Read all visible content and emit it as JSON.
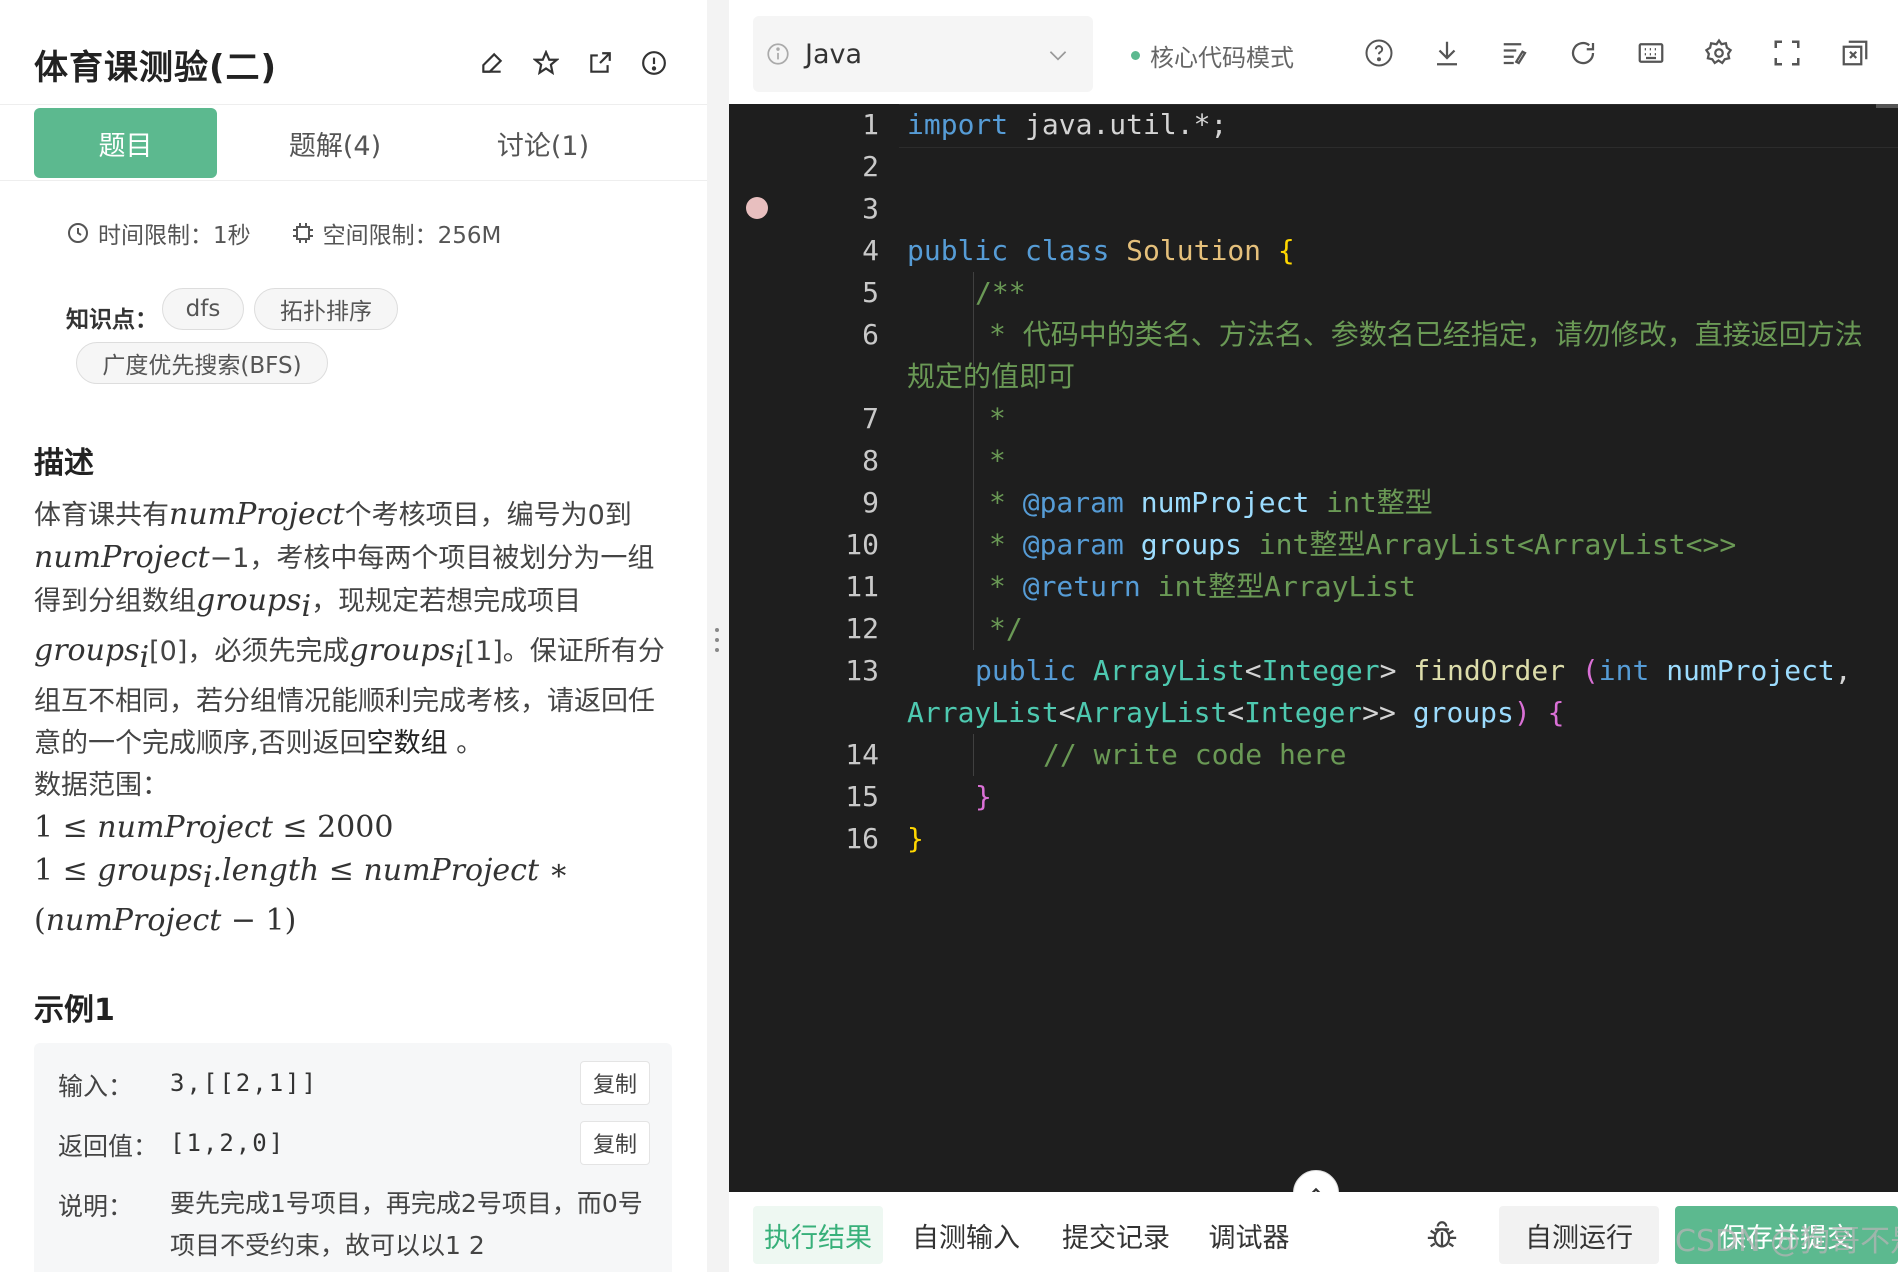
{
  "problem": {
    "title": "体育课测验(二)",
    "tabs": [
      "题目",
      "题解(4)",
      "讨论(1)"
    ],
    "time_limit": "时间限制：1秒",
    "space_limit": "空间限制：256M",
    "knowledge_label": "知识点：",
    "tags": [
      "dfs",
      "拓扑排序",
      "广度优先搜索(BFS)"
    ],
    "desc_title": "描述",
    "desc": {
      "t1": "体育课共有",
      "v_numProject": "numProject",
      "t2": "个考核项目，编号为0到",
      "t3": "−1，考核中每两个项目被划分为一组得到分组数组",
      "v_groups": "groups",
      "sub_i": "i",
      "t4": "，现规定若想完成项目",
      "t5": "[0]，必须先完成",
      "t6": "[1]。保证所有分组互不相同，若分组情况能顺利完成考核，请返回任意的一个完成顺序,否则返回",
      "empty": "空数组",
      "t7": " 。",
      "range_label": "数据范围：",
      "r1a": "1 ≤ ",
      "r1b": " ≤ 2000",
      "r2a": "1 ≤ ",
      "r2b": ".length ≤ ",
      "r2c": " ∗",
      "r3a": "(",
      "r3b": " − 1)"
    },
    "example": {
      "title": "示例1",
      "input_label": "输入：",
      "input_value": "3,[[2,1]]",
      "return_label": "返回值：",
      "return_value": "[1,2,0]",
      "copy_label": "复制",
      "explain_label": "说明：",
      "explain_text": "要先完成1号项目，再完成2号项目，而0号项目不受约束，故可以以1  2"
    }
  },
  "editor": {
    "language": "Java",
    "mode": "核心代码模式",
    "line_numbers": [
      "1",
      "2",
      "3",
      "4",
      "5",
      "6",
      "7",
      "8",
      "9",
      "10",
      "11",
      "12",
      "13",
      "14",
      "15",
      "16"
    ],
    "code": {
      "l1_kw": "import",
      "l1_rest": " java.util.*;",
      "l4_kw1": "public",
      "l4_kw2": "class",
      "l4_name": "Solution",
      "l4_br": "{",
      "l5": "/**",
      "l6": "* 代码中的类名、方法名、参数名已经指定，请勿修改，直接返回方法",
      "l6b": "规定的值即可",
      "l7": "*",
      "l8": "*",
      "l9_star": "* ",
      "l9_tag": "@param",
      "l9_name": "numProject",
      "l9_rest": " int整型",
      "l10_star": "* ",
      "l10_tag": "@param",
      "l10_name": "groups",
      "l10_rest": " int整型ArrayList<ArrayList<>>",
      "l11_star": "* ",
      "l11_tag": "@return",
      "l11_rest": " int整型ArrayList",
      "l12": "*/",
      "l13_kw": "public",
      "l13_t1": "ArrayList",
      "l13_t2": "Integer",
      "l13_fn": "findOrder",
      "l13_p": "(",
      "l13_int": "int",
      "l13_arg1": "numProject",
      "l13b_t1": "ArrayList",
      "l13b_t2": "ArrayList",
      "l13b_t3": "Integer",
      "l13b_arg2": "groups",
      "l13b_p": ")",
      "l13b_br": "{",
      "l14": "// write code here",
      "l15": "}",
      "l16": "}"
    }
  },
  "bottom": {
    "tabs": [
      "执行结果",
      "自测输入",
      "提交记录",
      "调试器"
    ],
    "run": "自测运行",
    "submit": "保存并提交"
  },
  "watermark": "CSDN @狗哥不是甜妹"
}
